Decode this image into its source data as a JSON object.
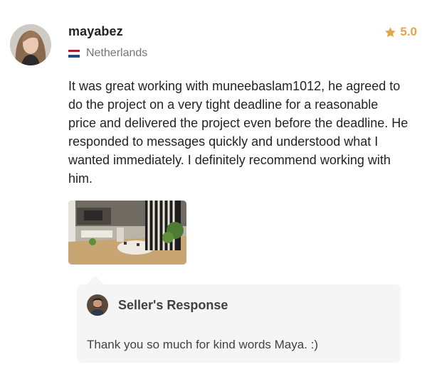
{
  "review": {
    "username": "mayabez",
    "country": "Netherlands",
    "rating": "5.0",
    "text": "It was great working with muneebaslam1012, he agreed to do the project on a very tight deadline for a reasonable price and delivered the project even before the deadline. He responded to messages quickly and understood what I wanted immediately. I definitely recommend working with him.",
    "icons": {
      "rating": "star-icon",
      "country": "netherlands-flag-icon"
    },
    "colors": {
      "star": "#e1a54b",
      "flag_red": "#ae1c28",
      "flag_blue": "#21468b"
    }
  },
  "seller_response": {
    "title": "Seller's Response",
    "text": "Thank you so much for kind words Maya. :)"
  }
}
